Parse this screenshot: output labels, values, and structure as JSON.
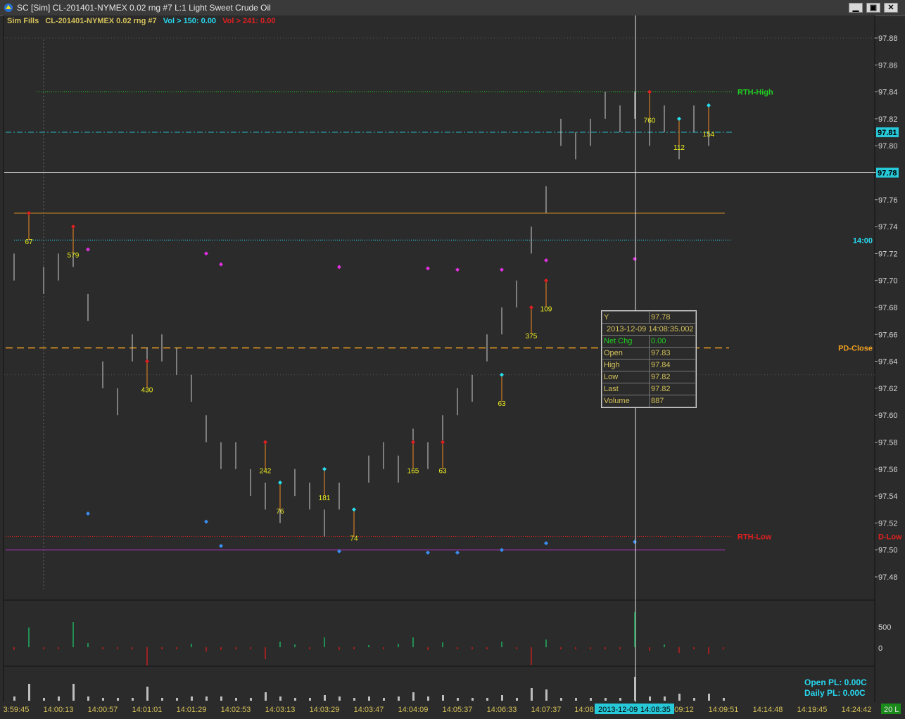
{
  "window": {
    "title": "SC [Sim] CL-201401-NYMEX  0.02 rng  #7  L:1  Light Sweet Crude Oil",
    "minimize_icon": "minimize-icon",
    "restore_icon": "restore-icon",
    "close_icon": "close-icon"
  },
  "legend": {
    "study": "Sim Fills",
    "symbol": "CL-201401-NYMEX  0.02 rng  #7",
    "vol_up": "Vol > 150: 0.00",
    "vol_down": "Vol > 241: 0.00"
  },
  "colors": {
    "up": "#27e0f0",
    "down": "#e02020",
    "magenta": "#e030e0",
    "blue": "#3a8ef0",
    "orange": "#f08a20",
    "green": "#20d020",
    "label_yellow": "#f0f020",
    "axis_text": "#d9d9d9",
    "time_axis": "#d6c25a"
  },
  "price_axis": {
    "ticks": [
      "97.88",
      "97.86",
      "97.84",
      "97.82",
      "97.80",
      "97.78",
      "97.76",
      "97.74",
      "97.72",
      "97.70",
      "97.68",
      "97.66",
      "97.64",
      "97.62",
      "97.60",
      "97.58",
      "97.56",
      "97.54",
      "97.52",
      "97.50",
      "97.48"
    ],
    "last_price_tag": "97.81",
    "crosshair_price_tag": "97.78",
    "volume_ticks": [
      "500",
      "0"
    ]
  },
  "levels": [
    {
      "name": "RTH-High",
      "price": 97.84,
      "color": "#20d020",
      "style": "dotted"
    },
    {
      "name": "14:00",
      "price": 97.73,
      "color": "#27d9f0",
      "style": "dotted"
    },
    {
      "name": "PD-Close",
      "price": 97.65,
      "color": "#f0a020",
      "style": "dashed"
    },
    {
      "name": "RTH-Low",
      "price": 97.51,
      "color": "#e02020",
      "style": "dotted"
    },
    {
      "name": "D-Low",
      "price": 97.51,
      "color": "#e02020",
      "style": "dotted"
    }
  ],
  "time_axis": {
    "labels": [
      "3:59:45",
      "14:00:13",
      "14:00:57",
      "14:01:01",
      "14:01:29",
      "14:02:53",
      "14:03:13",
      "14:03:29",
      "14:03:47",
      "14:04:09",
      "14:05:37",
      "14:06:33",
      "14:07:37",
      "14:08",
      "09:12",
      "14:09:51",
      "14:14:48",
      "14:19:45",
      "14:24:42"
    ],
    "crosshair_date": "2013-12-09",
    "crosshair_time": "14:08:35",
    "right_box": "20 L"
  },
  "chart_data": {
    "type": "range-bar",
    "bars_high_low": [
      [
        97.72,
        97.7
      ],
      [
        97.75,
        97.73
      ],
      [
        97.71,
        97.69
      ],
      [
        97.72,
        97.7
      ],
      [
        97.73,
        97.71
      ],
      [
        97.69,
        97.67
      ],
      [
        97.64,
        97.62
      ],
      [
        97.62,
        97.6
      ],
      [
        97.66,
        97.64
      ],
      [
        97.65,
        97.63
      ],
      [
        97.66,
        97.64
      ],
      [
        97.65,
        97.63
      ],
      [
        97.63,
        97.61
      ],
      [
        97.6,
        97.58
      ],
      [
        97.58,
        97.56
      ],
      [
        97.58,
        97.56
      ],
      [
        97.56,
        97.54
      ],
      [
        97.55,
        97.53
      ],
      [
        97.54,
        97.52
      ],
      [
        97.56,
        97.54
      ],
      [
        97.55,
        97.53
      ],
      [
        97.53,
        97.51
      ],
      [
        97.55,
        97.53
      ],
      [
        97.53,
        97.51
      ],
      [
        97.57,
        97.55
      ],
      [
        97.58,
        97.56
      ],
      [
        97.57,
        97.55
      ],
      [
        97.59,
        97.57
      ],
      [
        97.58,
        97.56
      ],
      [
        97.6,
        97.58
      ],
      [
        97.62,
        97.6
      ],
      [
        97.63,
        97.61
      ],
      [
        97.66,
        97.64
      ],
      [
        97.68,
        97.66
      ],
      [
        97.7,
        97.68
      ],
      [
        97.74,
        97.72
      ],
      [
        97.77,
        97.75
      ],
      [
        97.82,
        97.8
      ],
      [
        97.81,
        97.79
      ],
      [
        97.82,
        97.8
      ],
      [
        97.84,
        97.82
      ],
      [
        97.83,
        97.81
      ],
      [
        97.84,
        97.82
      ],
      [
        97.82,
        97.8
      ],
      [
        97.83,
        97.81
      ],
      [
        97.81,
        97.79
      ],
      [
        97.83,
        97.81
      ],
      [
        97.82,
        97.8
      ]
    ],
    "fills": [
      {
        "price": 97.75,
        "label": "67",
        "color": "#e02020"
      },
      {
        "price": 97.74,
        "label": "579",
        "color": "#e02020"
      },
      {
        "price": 97.64,
        "label": "430",
        "color": "#e02020"
      },
      {
        "price": 97.58,
        "label": "242",
        "color": "#e02020"
      },
      {
        "price": 97.55,
        "label": "76",
        "color": "#27e0f0"
      },
      {
        "price": 97.56,
        "label": "181",
        "color": "#27e0f0"
      },
      {
        "price": 97.53,
        "label": "74",
        "color": "#27e0f0"
      },
      {
        "price": 97.58,
        "label": "165",
        "color": "#e02020"
      },
      {
        "price": 97.58,
        "label": "63",
        "color": "#e02020"
      },
      {
        "price": 97.63,
        "label": "63",
        "color": "#27e0f0"
      },
      {
        "price": 97.68,
        "label": "375",
        "color": "#e02020"
      },
      {
        "price": 97.7,
        "label": "109",
        "color": "#e02020"
      },
      {
        "price": 97.84,
        "label": "760",
        "color": "#e02020"
      },
      {
        "price": 97.82,
        "label": "112",
        "color": "#27e0f0"
      },
      {
        "price": 97.83,
        "label": "154",
        "color": "#27e0f0"
      }
    ]
  },
  "tooltip": {
    "rows": [
      {
        "k": "Y",
        "v": "97.78"
      },
      {
        "k": "",
        "v": "2013-12-09   14:08:35.002"
      },
      {
        "k": "Net Chg",
        "v": "0.00"
      },
      {
        "k": "Open",
        "v": "97.83"
      },
      {
        "k": "High",
        "v": "97.84"
      },
      {
        "k": "Low",
        "v": "97.82"
      },
      {
        "k": "Last",
        "v": "97.82"
      },
      {
        "k": "Volume",
        "v": "887"
      }
    ]
  },
  "pnl": {
    "open": "Open PL: 0.00C",
    "daily": "Daily PL: 0.00C"
  }
}
